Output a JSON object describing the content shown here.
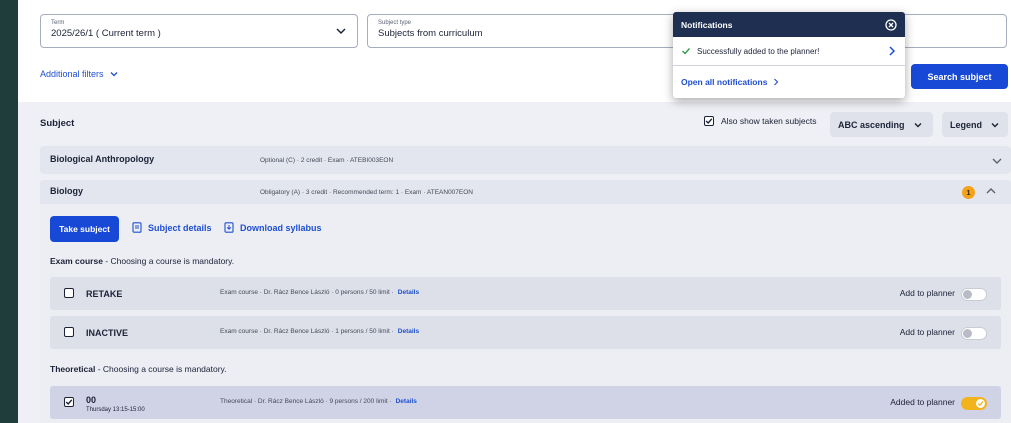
{
  "filters": {
    "term": {
      "label": "Term",
      "value": "2025/26/1 ( Current term )"
    },
    "subject_type": {
      "label": "Subject type",
      "value": "Subjects from curriculum"
    },
    "additional_filters": "Additional filters",
    "search_button": "Search subject"
  },
  "list": {
    "header": "Subject",
    "also_show_taken": "Also show taken subjects",
    "sort": "ABC ascending",
    "legend": "Legend"
  },
  "subjects": [
    {
      "name": "Biological Anthropology",
      "meta": "Optional (C) · 2 credit · Exam · ATEBI003EON"
    },
    {
      "name": "Biology",
      "meta": "Obligatory (A) · 3 credit · Recommended term: 1 · Exam · ATEAN007EON",
      "badge": "1"
    }
  ],
  "actions": {
    "take_subject": "Take subject",
    "subject_details": "Subject details",
    "download_syllabus": "Download syllabus"
  },
  "sections": [
    {
      "title": "Exam course",
      "note": " - Choosing a course is mandatory.",
      "courses": [
        {
          "name": "RETAKE",
          "meta": "Exam course · Dr. Rácz Bence László · 0 persons / 50 limit ·",
          "details": "Details",
          "planner": "Add to planner"
        },
        {
          "name": "INACTIVE",
          "meta": "Exam course · Dr. Rácz Bence László · 1 persons / 50 limit ·",
          "details": "Details",
          "planner": "Add to planner"
        }
      ]
    },
    {
      "title": "Theoretical",
      "note": " - Choosing a course is mandatory.",
      "courses": [
        {
          "name": "00",
          "time": "Thursday 13:15-15:00",
          "meta": "Theoretical · Dr. Rácz Bence László · 9 persons / 200 limit ·",
          "details": "Details",
          "planner": "Added to planner"
        }
      ]
    }
  ],
  "notifications": {
    "title": "Notifications",
    "message": "Successfully added to the planner!",
    "open_all": "Open all notifications"
  },
  "colors": {
    "primary": "#1849d6",
    "header_dark": "#1f2f52",
    "accent": "#f3b31c",
    "success": "#2e9b4a"
  }
}
